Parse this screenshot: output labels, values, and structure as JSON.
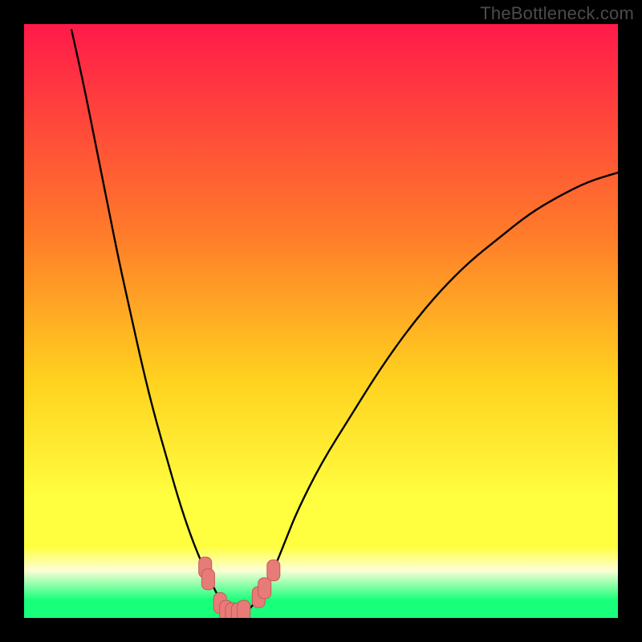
{
  "watermark": "TheBottleneck.com",
  "colors": {
    "frame": "#000000",
    "gradient_top": "#ff1a4a",
    "gradient_mid1": "#ff7a2a",
    "gradient_mid2": "#ffd21f",
    "gradient_mid3": "#ffff40",
    "gradient_band_pale": "#fdffd6",
    "gradient_green": "#18ff7a",
    "curve": "#000000",
    "marker_fill": "#e77b78",
    "marker_stroke": "#c45a57"
  },
  "chart_data": {
    "type": "line",
    "title": "",
    "xlabel": "",
    "ylabel": "",
    "xlim": [
      0,
      100
    ],
    "ylim": [
      0,
      100
    ],
    "x": [
      8,
      10,
      12,
      14,
      16,
      18,
      20,
      22,
      24,
      26,
      28,
      30,
      32,
      33,
      34,
      35,
      36,
      37,
      38,
      40,
      42,
      44,
      46,
      50,
      55,
      60,
      65,
      70,
      75,
      80,
      85,
      90,
      95,
      100
    ],
    "values": [
      99,
      90,
      80,
      70,
      60,
      51,
      42,
      34,
      27,
      20,
      14,
      9,
      5,
      3,
      1.5,
      0.8,
      0.5,
      0.8,
      1.5,
      4,
      8,
      13,
      18,
      26,
      34,
      42,
      49,
      55,
      60,
      64,
      68,
      71,
      73.5,
      75
    ],
    "curve_notes": "V-shaped bottleneck curve: steep descent on left, minimum near x≈35, shallower rise on right",
    "markers": [
      {
        "x": 30.5,
        "y": 8.5
      },
      {
        "x": 31,
        "y": 6.5
      },
      {
        "x": 33,
        "y": 2.5
      },
      {
        "x": 34,
        "y": 1.2
      },
      {
        "x": 35,
        "y": 0.8
      },
      {
        "x": 36,
        "y": 0.8
      },
      {
        "x": 37,
        "y": 1.2
      },
      {
        "x": 39.5,
        "y": 3.5
      },
      {
        "x": 40.5,
        "y": 5.0
      },
      {
        "x": 42,
        "y": 8.0
      }
    ]
  }
}
